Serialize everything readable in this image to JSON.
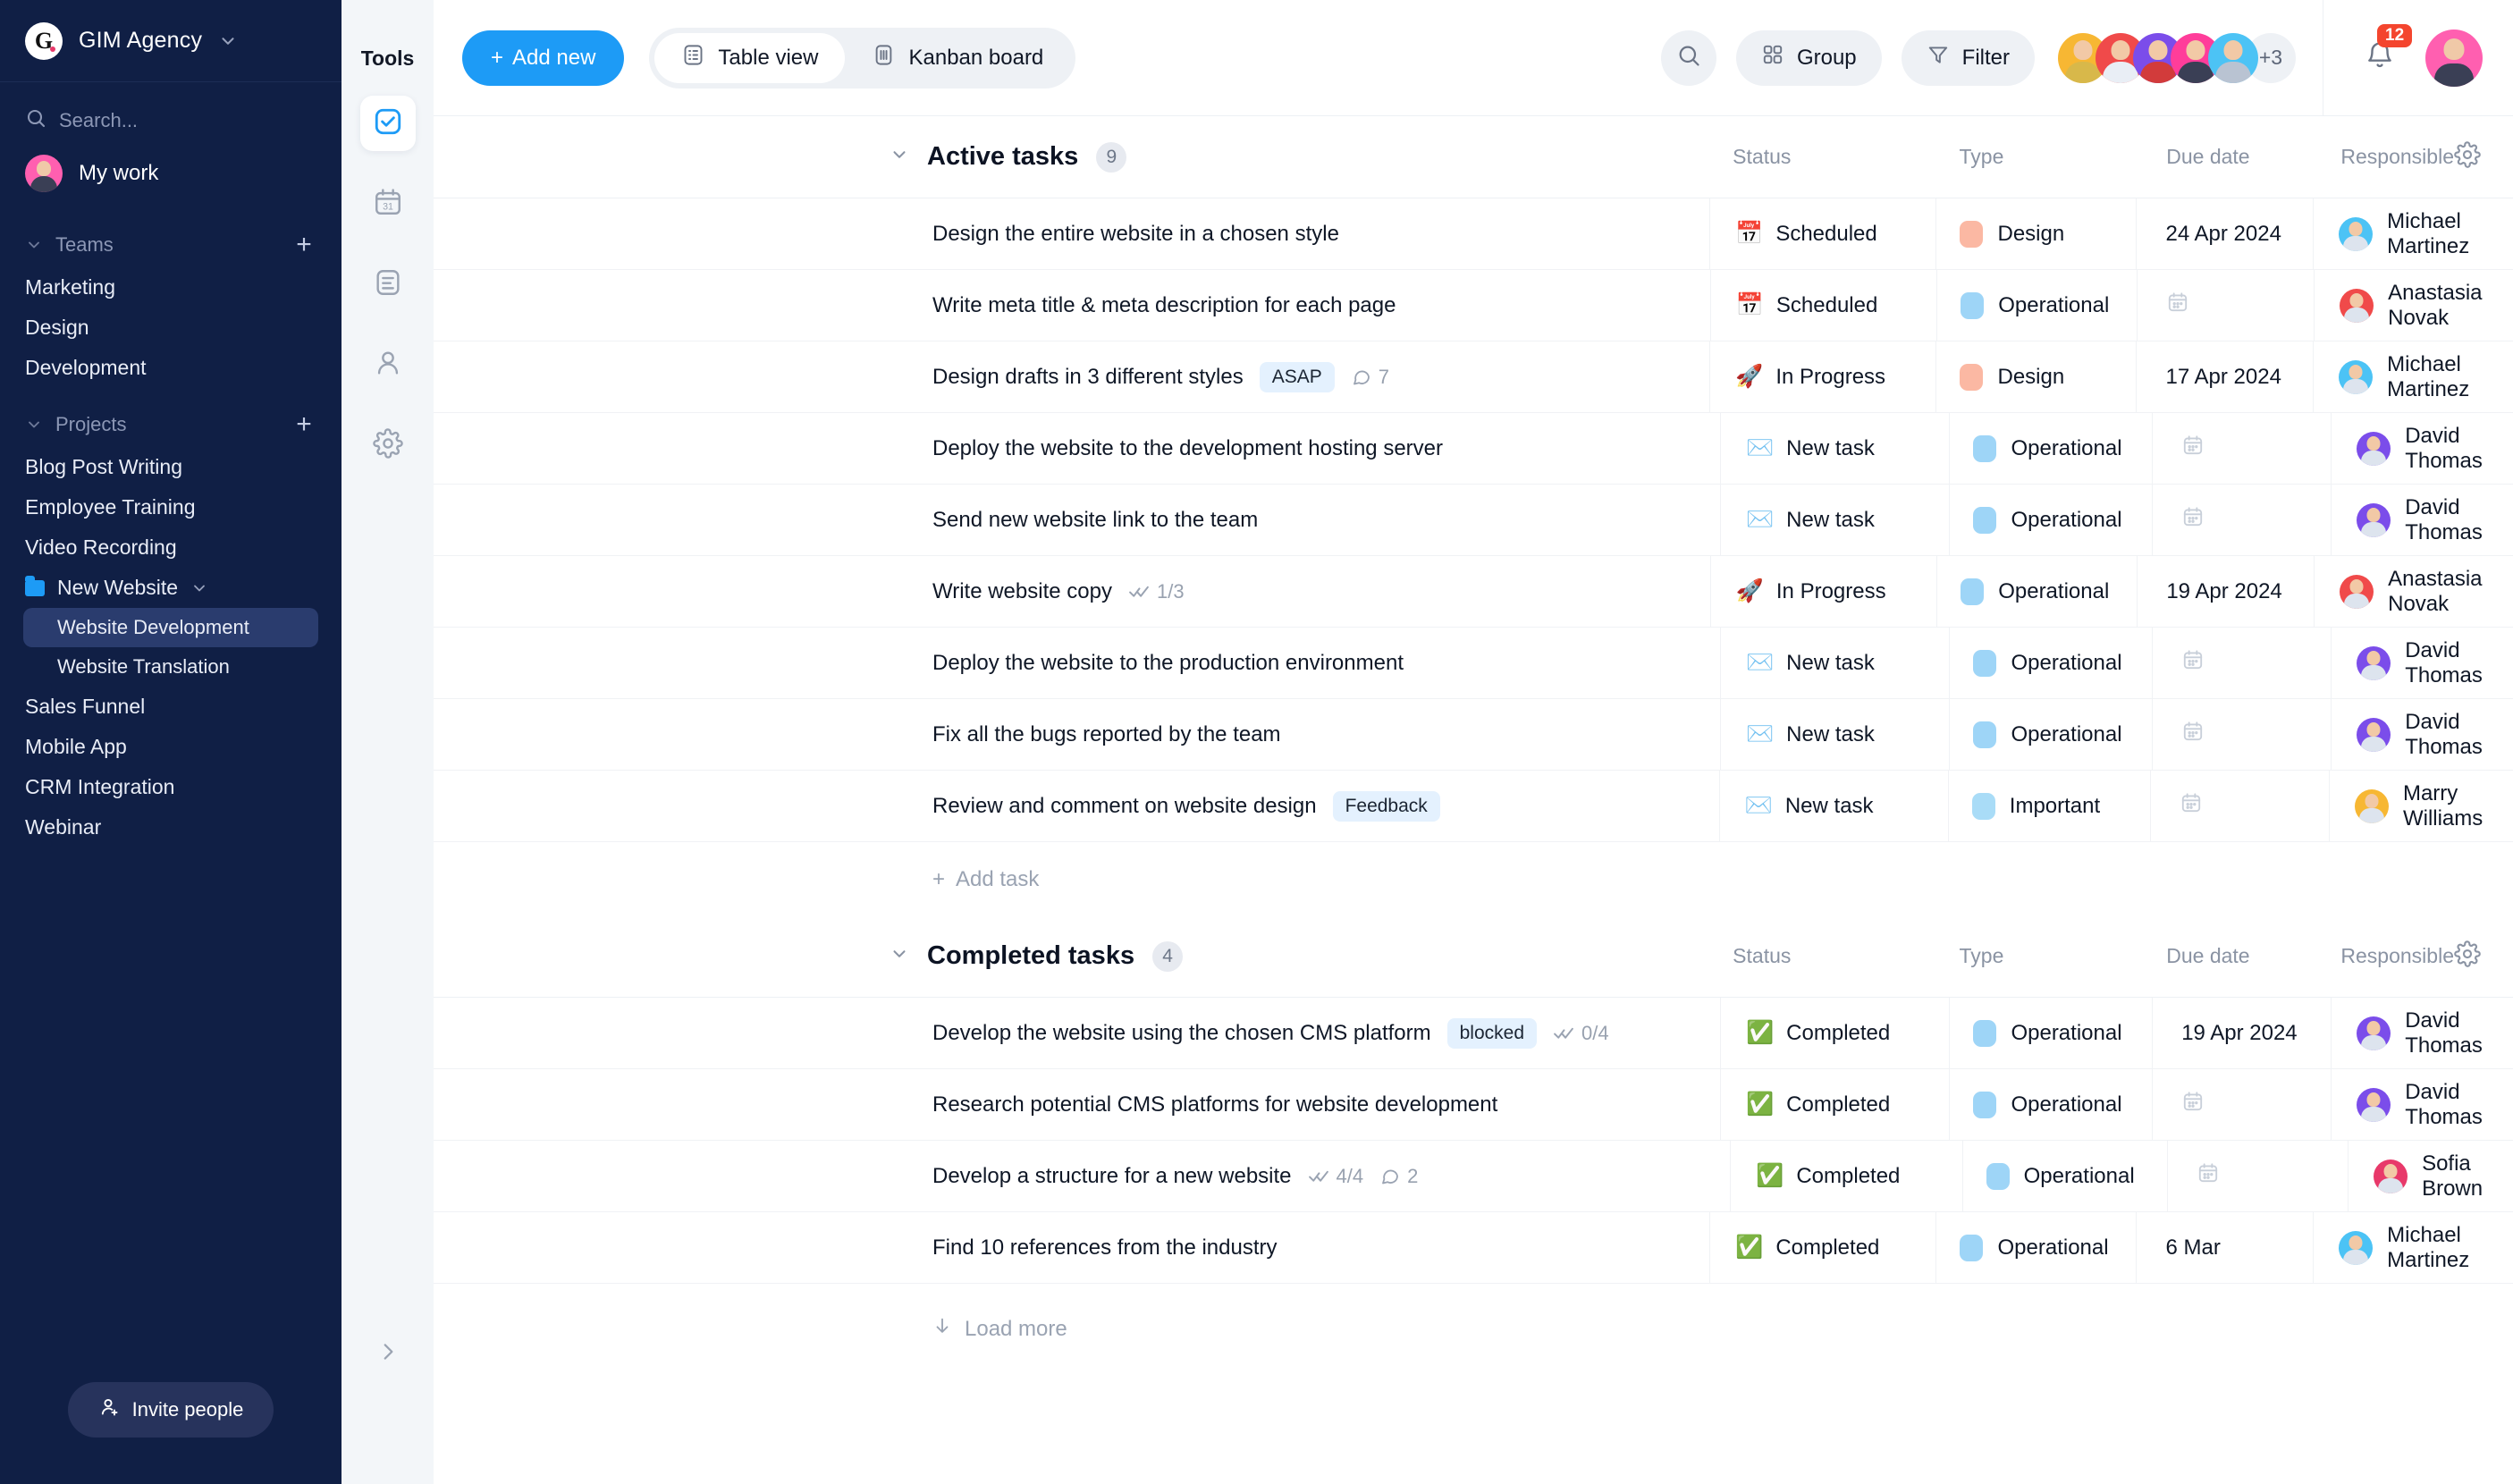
{
  "sidebar": {
    "brand": {
      "logo_letter": "G",
      "name": "GIM Agency",
      "chevron": "chevron-down"
    },
    "search": {
      "placeholder": "Search...",
      "value": ""
    },
    "my_work": "My work",
    "teams": {
      "label": "Teams",
      "add": "+",
      "items": [
        "Marketing",
        "Design",
        "Development"
      ]
    },
    "projects": {
      "label": "Projects",
      "add": "+",
      "items": [
        {
          "label": "Blog Post Writing",
          "type": "project"
        },
        {
          "label": "Employee Training",
          "type": "project"
        },
        {
          "label": "Video Recording",
          "type": "project"
        },
        {
          "label": "New Website",
          "type": "folder",
          "expanded": true
        },
        {
          "label": "Website Development",
          "type": "child",
          "active": true
        },
        {
          "label": "Website Translation",
          "type": "child",
          "active": false
        },
        {
          "label": "Sales Funnel",
          "type": "project"
        },
        {
          "label": "Mobile App",
          "type": "project"
        },
        {
          "label": "CRM Integration",
          "type": "project"
        },
        {
          "label": "Webinar",
          "type": "project"
        }
      ]
    },
    "invite_label": "Invite people"
  },
  "tools_rail": {
    "title": "Tools",
    "items": [
      {
        "name": "tasks-icon",
        "active": true
      },
      {
        "name": "calendar-icon",
        "active": false
      },
      {
        "name": "docs-icon",
        "active": false
      },
      {
        "name": "contacts-icon",
        "active": false
      },
      {
        "name": "settings-icon",
        "active": false
      }
    ],
    "collapse": "chevron-right"
  },
  "toolbar": {
    "add_new": "Add new",
    "views": [
      {
        "label": "Table view",
        "icon": "table-icon",
        "active": true
      },
      {
        "label": "Kanban board",
        "icon": "kanban-icon",
        "active": false
      }
    ],
    "search_icon": "search-icon",
    "group": "Group",
    "filter": "Filter",
    "avatars": [
      {
        "color": "#f7b733"
      },
      {
        "color": "#f04a4a"
      },
      {
        "color": "#7b4dea"
      },
      {
        "color": "#ff3d9a"
      },
      {
        "color": "#4cc3f5"
      }
    ],
    "avatar_overflow": "+3",
    "notification_count": "12"
  },
  "columns": {
    "task": "",
    "status": "Status",
    "type": "Type",
    "due_date": "Due date",
    "responsible": "Responsible"
  },
  "sections": [
    {
      "title": "Active tasks",
      "count": "9",
      "add_task": "Add task",
      "rows": [
        {
          "task": "Design the entire website in a chosen style",
          "tag": "",
          "subtasks": "",
          "comments": "",
          "status": "Scheduled",
          "status_icon": "📅",
          "type": "Design",
          "type_color": "#fbb8a3",
          "due": "24 Apr 2024",
          "resp": "Michael Martinez",
          "resp_color": "#4cc3f5"
        },
        {
          "task": "Write meta title & meta description for each page",
          "tag": "",
          "subtasks": "",
          "comments": "",
          "status": "Scheduled",
          "status_icon": "📅",
          "type": "Operational",
          "type_color": "#9ed5f7",
          "due": "",
          "resp": "Anastasia Novak",
          "resp_color": "#f04a4a"
        },
        {
          "task": "Design drafts in 3 different styles",
          "tag": "ASAP",
          "subtasks": "",
          "comments": "7",
          "status": "In Progress",
          "status_icon": "🚀",
          "type": "Design",
          "type_color": "#fbb8a3",
          "due": "17 Apr 2024",
          "resp": "Michael Martinez",
          "resp_color": "#4cc3f5"
        },
        {
          "task": "Deploy the website to the development hosting server",
          "tag": "",
          "subtasks": "",
          "comments": "",
          "status": "New task",
          "status_icon": "✉️",
          "type": "Operational",
          "type_color": "#9ed5f7",
          "due": "",
          "resp": "David Thomas",
          "resp_color": "#7b4dea"
        },
        {
          "task": "Send new website link to the team",
          "tag": "",
          "subtasks": "",
          "comments": "",
          "status": "New task",
          "status_icon": "✉️",
          "type": "Operational",
          "type_color": "#9ed5f7",
          "due": "",
          "resp": "David Thomas",
          "resp_color": "#7b4dea"
        },
        {
          "task": "Write website copy",
          "tag": "",
          "subtasks": "1/3",
          "comments": "",
          "status": "In Progress",
          "status_icon": "🚀",
          "type": "Operational",
          "type_color": "#9ed5f7",
          "due": "19 Apr 2024",
          "resp": "Anastasia Novak",
          "resp_color": "#f04a4a"
        },
        {
          "task": "Deploy the website to the production environment",
          "tag": "",
          "subtasks": "",
          "comments": "",
          "status": "New task",
          "status_icon": "✉️",
          "type": "Operational",
          "type_color": "#9ed5f7",
          "due": "",
          "resp": "David Thomas",
          "resp_color": "#7b4dea"
        },
        {
          "task": "Fix all the bugs reported by the team",
          "tag": "",
          "subtasks": "",
          "comments": "",
          "status": "New task",
          "status_icon": "✉️",
          "type": "Operational",
          "type_color": "#9ed5f7",
          "due": "",
          "resp": "David Thomas",
          "resp_color": "#7b4dea"
        },
        {
          "task": "Review and comment on website design",
          "tag": "Feedback",
          "subtasks": "",
          "comments": "",
          "status": "New task",
          "status_icon": "✉️",
          "type": "Important",
          "type_color": "#a9dcf7",
          "due": "",
          "resp": "Marry Williams",
          "resp_color": "#f7b733"
        }
      ]
    },
    {
      "title": "Completed tasks",
      "count": "4",
      "load_more": "Load more",
      "rows": [
        {
          "task": "Develop the website using the chosen CMS platform",
          "tag": "blocked",
          "subtasks": "0/4",
          "comments": "",
          "status": "Completed",
          "status_icon": "✅",
          "type": "Operational",
          "type_color": "#9ed5f7",
          "due": "19 Apr 2024",
          "resp": "David Thomas",
          "resp_color": "#7b4dea"
        },
        {
          "task": "Research potential CMS platforms for website development",
          "tag": "",
          "subtasks": "",
          "comments": "",
          "status": "Completed",
          "status_icon": "✅",
          "type": "Operational",
          "type_color": "#9ed5f7",
          "due": "",
          "resp": "David Thomas",
          "resp_color": "#7b4dea"
        },
        {
          "task": "Develop a structure for a new website",
          "tag": "",
          "subtasks": "4/4",
          "comments": "2",
          "status": "Completed",
          "status_icon": "✅",
          "type": "Operational",
          "type_color": "#9ed5f7",
          "due": "",
          "resp": "Sofia Brown",
          "resp_color": "#e8396a"
        },
        {
          "task": "Find 10 references from the industry",
          "tag": "",
          "subtasks": "",
          "comments": "",
          "status": "Completed",
          "status_icon": "✅",
          "type": "Operational",
          "type_color": "#9ed5f7",
          "due": "6 Mar",
          "resp": "Michael Martinez",
          "resp_color": "#4cc3f5"
        }
      ]
    }
  ],
  "colors": {
    "accent": "#1d9bf6",
    "sidebar_bg": "#101f45",
    "sidebar_active": "#2a3c6e",
    "badge_red": "#f4452e"
  }
}
